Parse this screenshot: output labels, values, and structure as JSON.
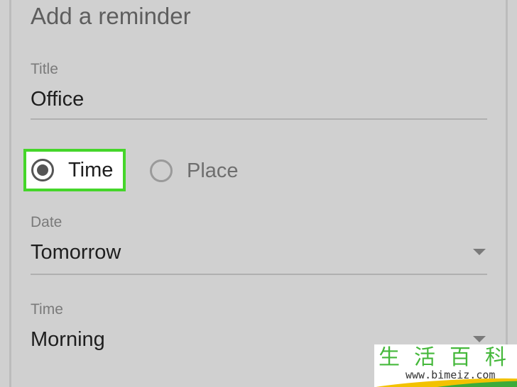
{
  "dialog": {
    "title": "Add a reminder"
  },
  "fields": {
    "title": {
      "label": "Title",
      "value": "Office"
    },
    "type": {
      "options": [
        {
          "label": "Time",
          "selected": true
        },
        {
          "label": "Place",
          "selected": false
        }
      ]
    },
    "date": {
      "label": "Date",
      "value": "Tomorrow"
    },
    "time": {
      "label": "Time",
      "value": "Morning"
    }
  },
  "icons": {
    "dropdown": "caret-down-icon",
    "radio_selected": "radio-checked-icon",
    "radio_unselected": "radio-unchecked-icon"
  },
  "highlight_color": "#45d62a",
  "watermark": {
    "cjk": "生活百科",
    "url": "www.bimeiz.com"
  }
}
